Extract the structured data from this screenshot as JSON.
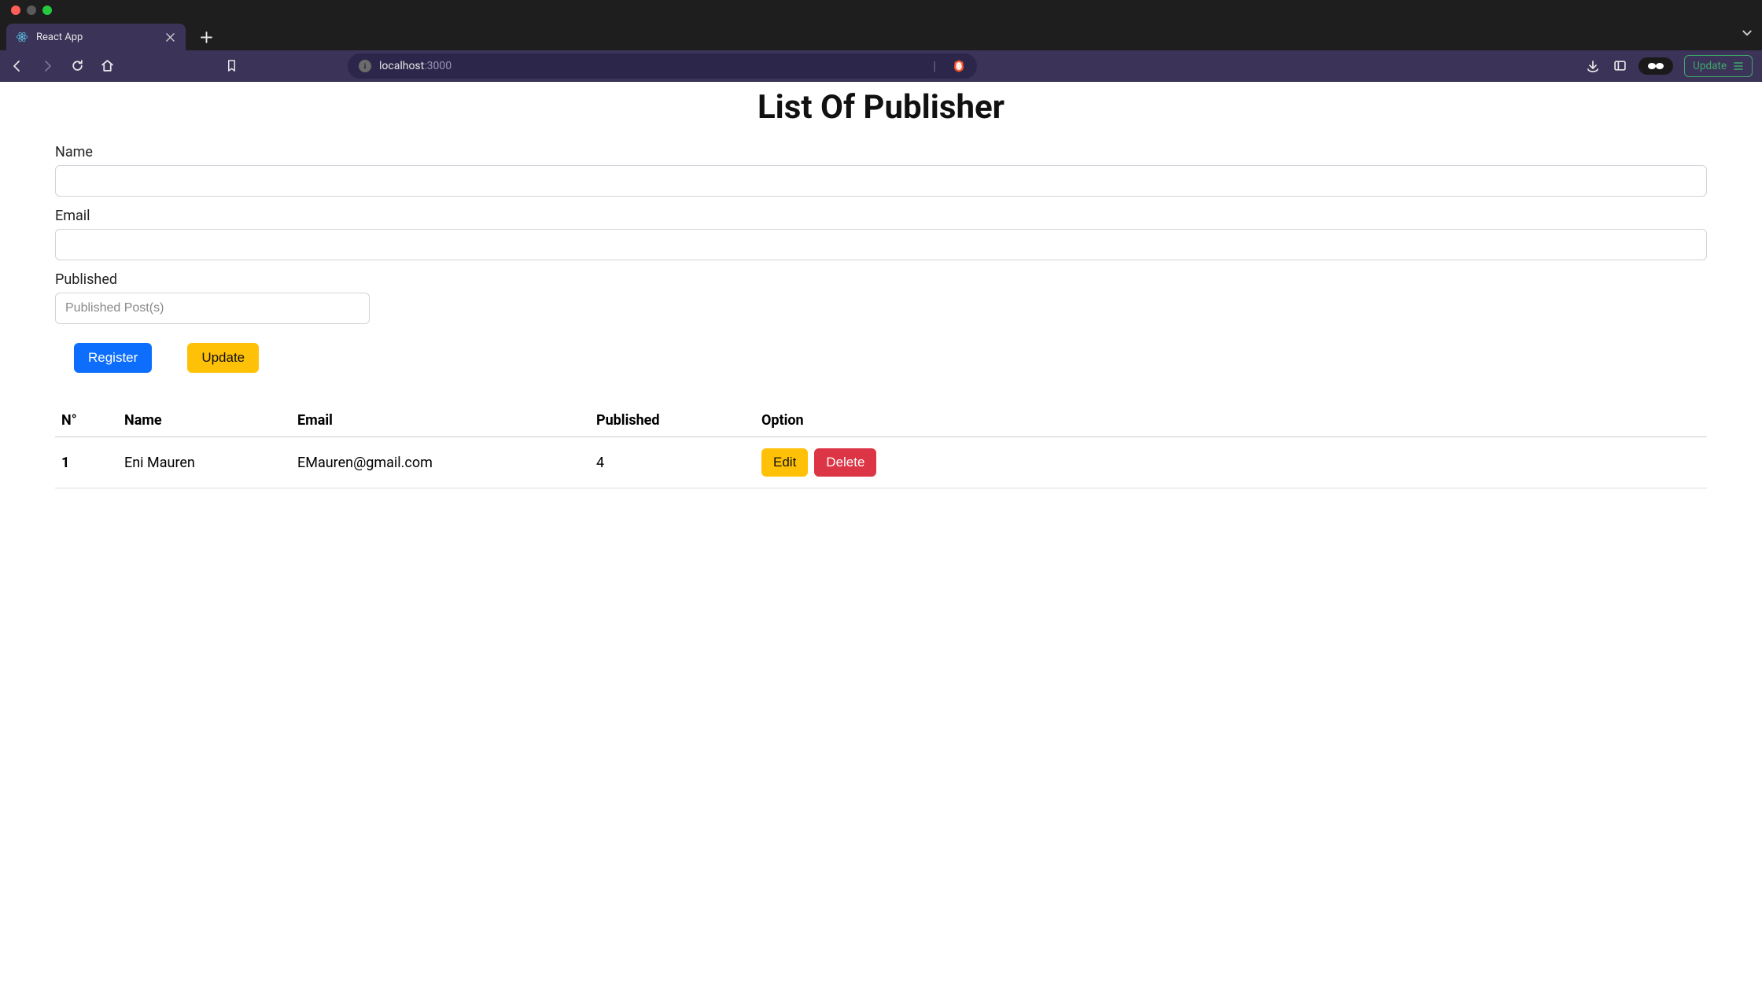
{
  "browser": {
    "tab_title": "React App",
    "url_host": "localhost",
    "url_port": ":3000",
    "update_label": "Update"
  },
  "page": {
    "title": "List Of Publisher",
    "form": {
      "name_label": "Name",
      "email_label": "Email",
      "published_label": "Published",
      "published_placeholder": "Published Post(s)",
      "register_btn": "Register",
      "update_btn": "Update"
    },
    "table": {
      "headers": {
        "no": "N°",
        "name": "Name",
        "email": "Email",
        "published": "Published",
        "option": "Option"
      },
      "rows": [
        {
          "no": "1",
          "name": "Eni Mauren",
          "email": "EMauren@gmail.com",
          "published": "4"
        }
      ],
      "edit_btn": "Edit",
      "delete_btn": "Delete"
    }
  }
}
